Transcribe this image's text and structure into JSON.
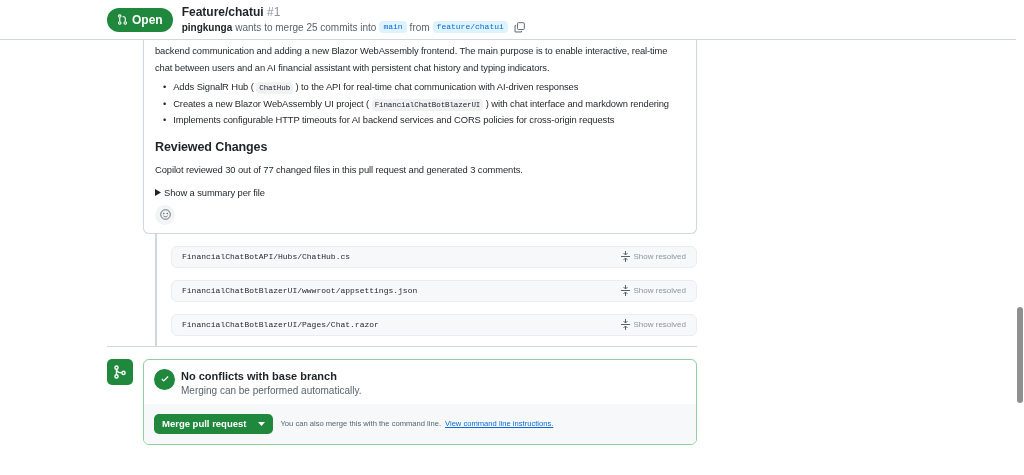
{
  "header": {
    "state": "Open",
    "title": "Feature/chatui",
    "number": "#1",
    "author": "pingkunga",
    "merge_text": "wants to merge 25 commits into",
    "base_branch": "main",
    "from_text": "from",
    "head_branch": "feature/chatui"
  },
  "description": {
    "paragraph": "backend communication and adding a new Blazor WebAssembly frontend. The main purpose is to enable interactive, real-time chat between users and an AI financial assistant with persistent chat history and typing indicators.",
    "bullets": [
      {
        "marker": "•",
        "before": "Adds SignalR Hub (",
        "code": "ChatHub",
        "after": ") to the API for real-time chat communication with AI-driven responses"
      },
      {
        "marker": "•",
        "before": "Creates a new Blazor WebAssembly UI project (",
        "code": "FinancialChatBotBlazerUI",
        "after": ") with chat interface and markdown rendering"
      },
      {
        "marker": "•",
        "before": "Implements configurable HTTP timeouts for AI backend services and CORS policies for cross-origin requests"
      }
    ],
    "heading": "Reviewed Changes",
    "summary": "Copilot reviewed 30 out of 77 changed files in this pull request and generated 3 comments.",
    "details": "Show a summary per file"
  },
  "files": [
    {
      "path": "FinancialChatBotAPI/Hubs/ChatHub.cs",
      "action": "Show resolved"
    },
    {
      "path": "FinancialChatBotBlazerUI/wwwroot/appsettings.json",
      "action": "Show resolved"
    },
    {
      "path": "FinancialChatBotBlazerUI/Pages/Chat.razor",
      "action": "Show resolved"
    }
  ],
  "merge": {
    "title": "No conflicts with base branch",
    "subtitle": "Merging can be performed automatically.",
    "button": "Merge pull request",
    "hint": "You can also merge this with the command line.",
    "link": "View command line instructions."
  }
}
